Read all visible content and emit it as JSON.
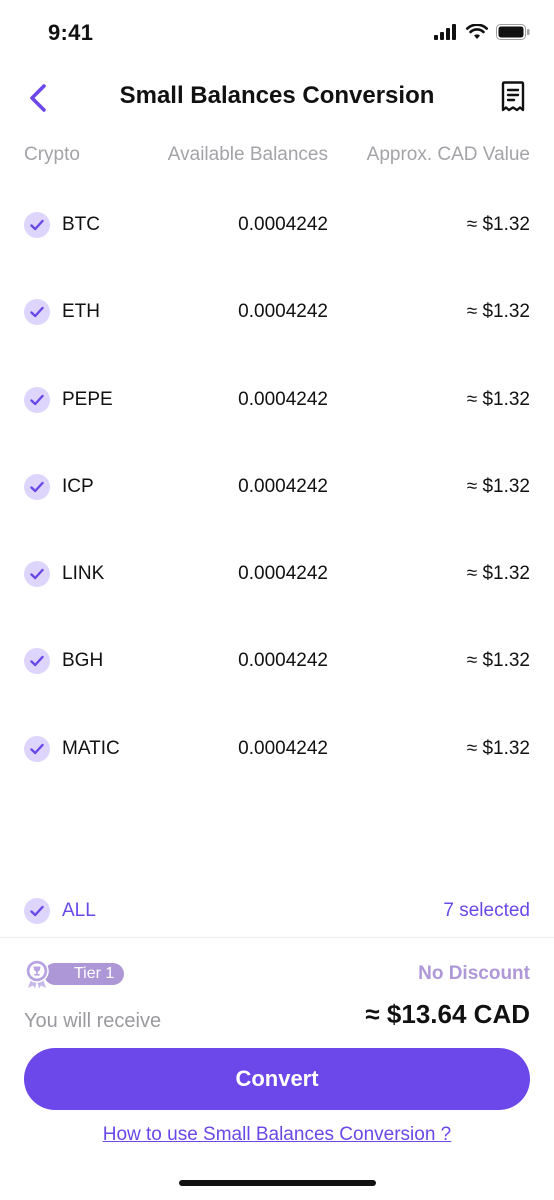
{
  "status_bar": {
    "time": "9:41",
    "icons": [
      "signal-icon",
      "wifi-icon",
      "battery-icon"
    ]
  },
  "header": {
    "title": "Small Balances Conversion",
    "back_icon": "chevron-left-icon",
    "action_icon": "receipt-icon"
  },
  "columns": {
    "crypto": "Crypto",
    "available": "Available Balances",
    "cad_value": "Approx. CAD Value"
  },
  "rows": [
    {
      "crypto": "BTC",
      "available": "0.0004242",
      "cad": "≈ $1.32",
      "checked": true
    },
    {
      "crypto": "ETH",
      "available": "0.0004242",
      "cad": "≈ $1.32",
      "checked": true
    },
    {
      "crypto": "PEPE",
      "available": "0.0004242",
      "cad": "≈ $1.32",
      "checked": true
    },
    {
      "crypto": "ICP",
      "available": "0.0004242",
      "cad": "≈ $1.32",
      "checked": true
    },
    {
      "crypto": "LINK",
      "available": "0.0004242",
      "cad": "≈ $1.32",
      "checked": true
    },
    {
      "crypto": "BGH",
      "available": "0.0004242",
      "cad": "≈ $1.32",
      "checked": true
    },
    {
      "crypto": "MATIC",
      "available": "0.0004242",
      "cad": "≈ $1.32",
      "checked": true
    }
  ],
  "select_all": {
    "label": "ALL",
    "selected_text": "7 selected",
    "checked": true
  },
  "summary": {
    "tier": "Tier 1",
    "discount": "No Discount",
    "receive_label": "You will receive",
    "receive_amount": "≈ $13.64 CAD"
  },
  "actions": {
    "convert": "Convert",
    "help_link": "How to use Small Balances Conversion ?"
  },
  "colors": {
    "accent": "#6c47ea",
    "check_bg": "#ddd5fb",
    "tier_badge": "#ad97d6",
    "muted_text": "#a3a3a8"
  }
}
